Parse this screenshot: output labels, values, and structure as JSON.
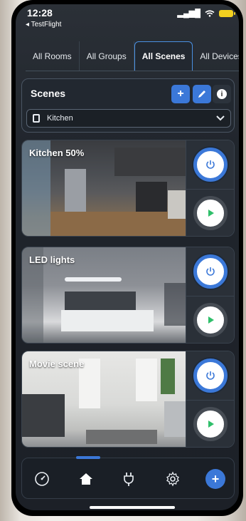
{
  "status_bar": {
    "time": "12:28",
    "back_app": "◂ TestFlight",
    "signal": "▂▄▆█",
    "wifi": "wifi"
  },
  "tabs": [
    {
      "label": "All Rooms"
    },
    {
      "label": "All Groups"
    },
    {
      "label": "All Scenes",
      "active": true
    },
    {
      "label": "All Devices"
    }
  ],
  "scenes_panel": {
    "title": "Scenes",
    "add_label": "+",
    "selected_room": "Kitchen"
  },
  "scene_cards": [
    {
      "title": "Kitchen 50%"
    },
    {
      "title": "LED lights"
    },
    {
      "title": "Movie scene"
    }
  ],
  "bottom_nav": {
    "items": [
      "gauge-icon",
      "home-icon",
      "plug-icon",
      "gear-icon",
      "add-icon"
    ],
    "add_label": "+",
    "active_index": 1
  },
  "colors": {
    "accent": "#3b78d8",
    "play_green": "#2fbf6a",
    "panel_bg": "#222830"
  }
}
